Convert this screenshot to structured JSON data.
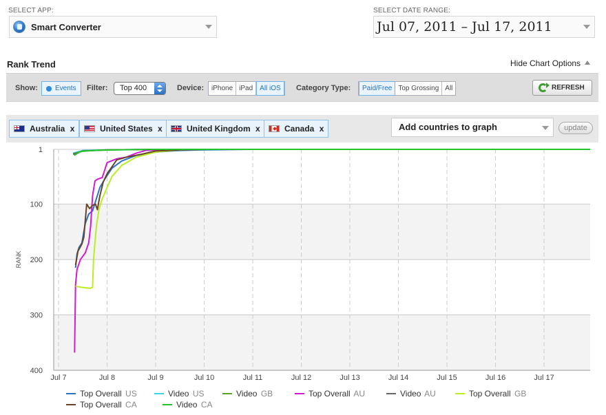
{
  "app_select": {
    "label": "SELECT APP:",
    "value": "Smart Converter",
    "icon": "app-icon"
  },
  "date_select": {
    "label": "SELECT DATE RANGE:",
    "value": "Jul 07, 2011 – Jul 17, 2011"
  },
  "section": {
    "title": "Rank Trend",
    "hide_options": "Hide Chart Options"
  },
  "options_bar": {
    "show_label": "Show:",
    "events_label": "Events",
    "filter_label": "Filter:",
    "filter_value": "Top 400",
    "device_label": "Device:",
    "devices": [
      "iPhone",
      "iPad",
      "All iOS"
    ],
    "device_selected": "All iOS",
    "category_label": "Category Type:",
    "categories": [
      "Paid/Free",
      "Top Grossing",
      "All"
    ],
    "category_selected": "Paid/Free",
    "refresh_label": "REFRESH"
  },
  "countries": {
    "chips": [
      {
        "name": "Australia",
        "remove": "x",
        "flag": "flag-au"
      },
      {
        "name": "United States",
        "remove": "x",
        "flag": "flag-us"
      },
      {
        "name": "United Kingdom",
        "remove": "x",
        "flag": "flag-gb"
      },
      {
        "name": "Canada",
        "remove": "x",
        "flag": "flag-ca"
      }
    ],
    "add_placeholder": "Add countries to graph",
    "update_label": "update"
  },
  "colors": {
    "top_overall_us": "#2b72c6",
    "video_us": "#33d6e8",
    "video_gb": "#55a329",
    "top_overall_au": "#d21ad6",
    "video_au": "#666666",
    "top_overall_gb": "#b8ee22",
    "top_overall_ca": "#6b4226",
    "video_ca": "#22c42a"
  },
  "chart_data": {
    "type": "line",
    "ylabel": "RANK",
    "xlabel": "",
    "y_inverted": true,
    "ylim": [
      1,
      400
    ],
    "yticks": [
      "1",
      "100",
      "200",
      "300",
      "400"
    ],
    "x_ticks": [
      "Jul 7",
      "Jul 8",
      "Jul 9",
      "Jul 10",
      "Jul 11",
      "Jul 12",
      "Jul 13",
      "Jul 14",
      "Jul 15",
      "Jul 16",
      "Jul 17"
    ],
    "xlim": [
      6.9,
      17.95
    ],
    "grid": true,
    "legend_position": "bottom",
    "series": [
      {
        "name": "Top Overall",
        "country": "US",
        "color_key": "top_overall_us",
        "points": [
          [
            7.35,
            215
          ],
          [
            7.38,
            190
          ],
          [
            7.42,
            178
          ],
          [
            7.48,
            170
          ],
          [
            7.55,
            135
          ],
          [
            7.62,
            118
          ],
          [
            7.7,
            112
          ],
          [
            7.78,
            90
          ],
          [
            7.85,
            70
          ],
          [
            7.95,
            55
          ],
          [
            8.1,
            35
          ],
          [
            8.3,
            22
          ],
          [
            8.6,
            12
          ],
          [
            9.0,
            6
          ],
          [
            9.5,
            3
          ],
          [
            10.0,
            2
          ],
          [
            11.0,
            1
          ],
          [
            17.95,
            1
          ]
        ]
      },
      {
        "name": "Video",
        "country": "US",
        "color_key": "video_us",
        "points": [
          [
            7.3,
            8
          ],
          [
            7.5,
            3
          ],
          [
            8.0,
            2
          ],
          [
            9.0,
            1
          ],
          [
            17.95,
            1
          ]
        ]
      },
      {
        "name": "Video",
        "country": "GB",
        "color_key": "video_gb",
        "points": [
          [
            7.3,
            9
          ],
          [
            7.5,
            4
          ],
          [
            8.0,
            2
          ],
          [
            9.0,
            1
          ],
          [
            17.95,
            1
          ]
        ]
      },
      {
        "name": "Top Overall",
        "country": "AU",
        "color_key": "top_overall_au",
        "points": [
          [
            7.33,
            368
          ],
          [
            7.35,
            245
          ],
          [
            7.38,
            218
          ],
          [
            7.45,
            200
          ],
          [
            7.55,
            188
          ],
          [
            7.62,
            170
          ],
          [
            7.66,
            140
          ],
          [
            7.7,
            85
          ],
          [
            7.75,
            58
          ],
          [
            7.8,
            55
          ],
          [
            7.9,
            52
          ],
          [
            8.0,
            25
          ],
          [
            8.2,
            18
          ],
          [
            8.4,
            15
          ],
          [
            8.6,
            8
          ],
          [
            8.8,
            3
          ],
          [
            9.2,
            1
          ],
          [
            17.95,
            1
          ]
        ]
      },
      {
        "name": "Video",
        "country": "AU",
        "color_key": "video_au",
        "points": [
          [
            7.3,
            10
          ],
          [
            7.5,
            4
          ],
          [
            8.0,
            2
          ],
          [
            9.0,
            1
          ],
          [
            17.95,
            1
          ]
        ]
      },
      {
        "name": "Top Overall",
        "country": "GB",
        "color_key": "top_overall_gb",
        "points": [
          [
            7.35,
            248
          ],
          [
            7.45,
            250
          ],
          [
            7.65,
            252
          ],
          [
            7.7,
            250
          ],
          [
            7.72,
            200
          ],
          [
            7.78,
            140
          ],
          [
            7.83,
            110
          ],
          [
            7.9,
            90
          ],
          [
            8.0,
            70
          ],
          [
            8.1,
            50
          ],
          [
            8.3,
            30
          ],
          [
            8.6,
            15
          ],
          [
            9.0,
            6
          ],
          [
            9.5,
            2
          ],
          [
            10.0,
            1
          ],
          [
            17.95,
            1
          ]
        ]
      },
      {
        "name": "Top Overall",
        "country": "CA",
        "color_key": "top_overall_ca",
        "points": [
          [
            7.35,
            210
          ],
          [
            7.4,
            185
          ],
          [
            7.48,
            172
          ],
          [
            7.52,
            160
          ],
          [
            7.58,
            100
          ],
          [
            7.64,
            108
          ],
          [
            7.7,
            102
          ],
          [
            7.76,
            100
          ],
          [
            7.8,
            110
          ],
          [
            7.85,
            85
          ],
          [
            7.92,
            60
          ],
          [
            8.0,
            45
          ],
          [
            8.2,
            20
          ],
          [
            8.4,
            15
          ],
          [
            8.7,
            10
          ],
          [
            9.0,
            4
          ],
          [
            9.5,
            2
          ],
          [
            10.0,
            1
          ],
          [
            17.95,
            1
          ]
        ]
      },
      {
        "name": "Video",
        "country": "CA",
        "color_key": "video_ca",
        "points": [
          [
            7.32,
            12
          ],
          [
            7.45,
            5
          ],
          [
            7.7,
            3
          ],
          [
            8.2,
            2
          ],
          [
            9.0,
            1
          ],
          [
            17.95,
            1
          ]
        ]
      }
    ]
  },
  "legend": [
    {
      "name": "Top Overall",
      "country": "US",
      "color_key": "top_overall_us"
    },
    {
      "name": "Video",
      "country": "US",
      "color_key": "video_us"
    },
    {
      "name": "Video",
      "country": "GB",
      "color_key": "video_gb"
    },
    {
      "name": "Top Overall",
      "country": "AU",
      "color_key": "top_overall_au"
    },
    {
      "name": "Video",
      "country": "AU",
      "color_key": "video_au"
    },
    {
      "name": "Top Overall",
      "country": "GB",
      "color_key": "top_overall_gb"
    },
    {
      "name": "Top Overall",
      "country": "CA",
      "color_key": "top_overall_ca"
    },
    {
      "name": "Video",
      "country": "CA",
      "color_key": "video_ca"
    }
  ]
}
